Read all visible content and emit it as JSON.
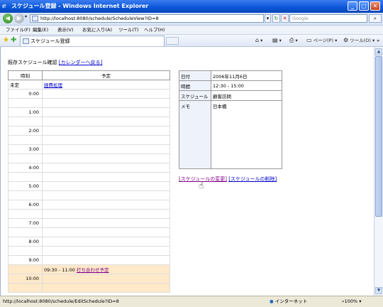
{
  "window": {
    "title": "スケジュール登録 - Windows Internet Explorer"
  },
  "address": {
    "url": "http://localhost:8080/schedule/ScheduleView?ID=8"
  },
  "search": {
    "placeholder": "Google"
  },
  "menu": [
    "ファイル(F)",
    "編集(E)",
    "表示(V)",
    "お気に入り(A)",
    "ツール(T)",
    "ヘルプ(H)"
  ],
  "tab": {
    "title": "スケジュール登録"
  },
  "commands": {
    "page": "ページ(P)",
    "tools": "ツール(O)"
  },
  "page": {
    "breadcrumb": "既存スケジュール確認",
    "back_link": "[カレンダーへ戻る]",
    "schedule_headers": {
      "time": "時刻",
      "plan": "予定"
    },
    "undecided_label": "未定",
    "undecided_event": "経費処理",
    "hours": [
      "0:00",
      "1:00",
      "2:00",
      "3:00",
      "4:00",
      "5:00",
      "6:00",
      "7:00",
      "8:00",
      "9:00",
      "10:00"
    ],
    "highlight_event": {
      "time": "09:30 - 11:00",
      "title": "打ち合わせ予定"
    },
    "detail": {
      "date_label": "日付",
      "date_value": "2006年11月6日",
      "time_label": "時間",
      "time_value": "12:30 - 15:00",
      "schedule_label": "スケジュール",
      "schedule_value": "顧客訪問",
      "memo_label": "メモ",
      "memo_value": "日本橋"
    },
    "edit_link": "[スケジュールの変更]",
    "delete_link": "[スケジュールの削除]"
  },
  "status": {
    "url": "http://localhost:8080/schedule/EditSchedule?ID=8",
    "zone": "インターネット",
    "zoom": "100%"
  }
}
